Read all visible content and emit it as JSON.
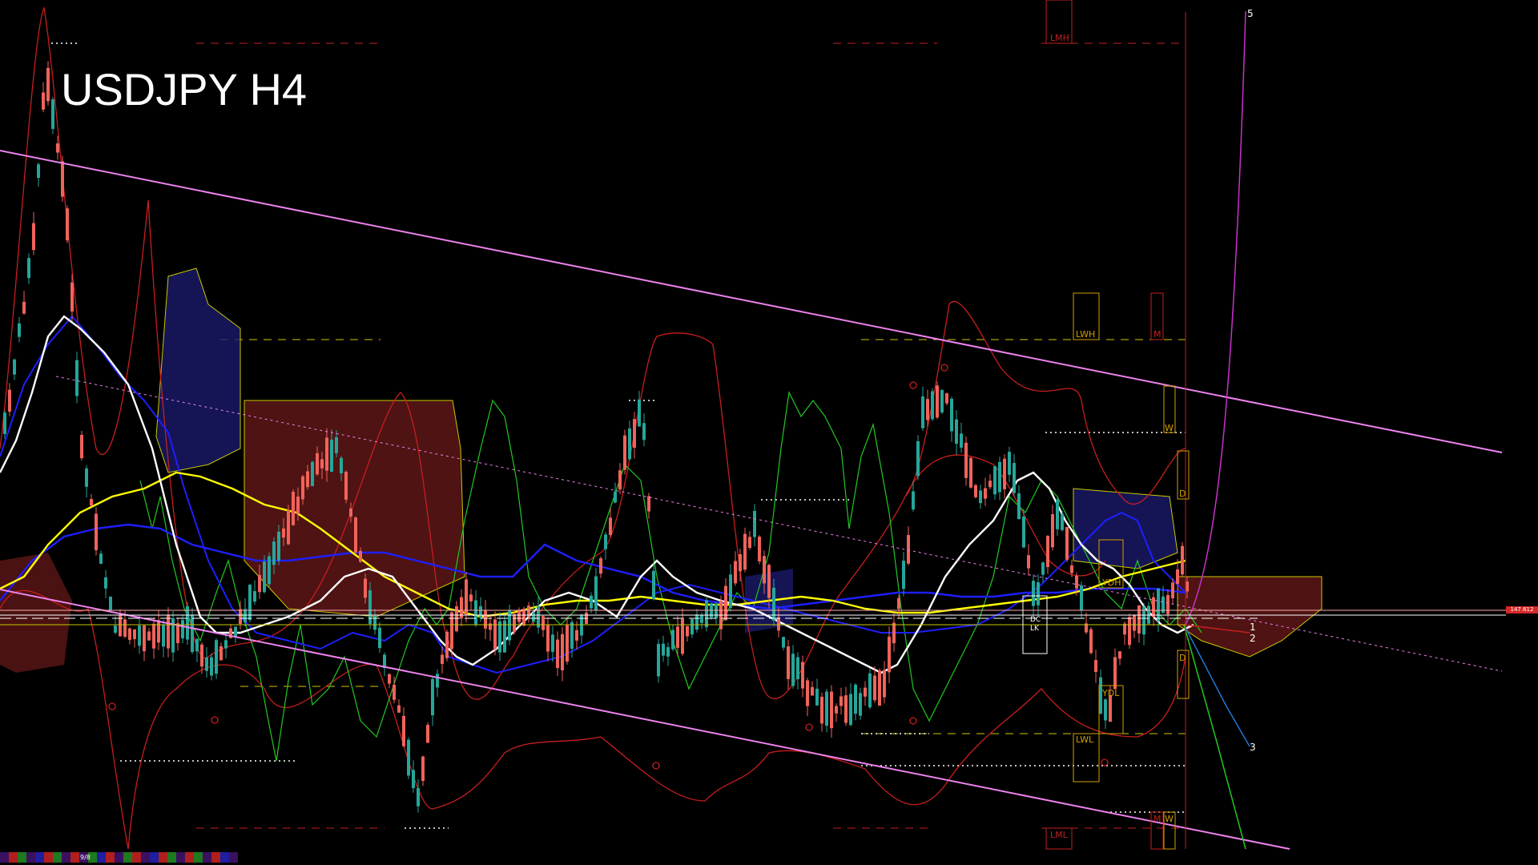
{
  "chart": {
    "title": "USDJPY H4",
    "price_tag": "147.612",
    "page_indicator": "9/8",
    "colors": {
      "background": "#000000",
      "bull_candle": "#26a69a",
      "bear_candle": "#f0635b",
      "channel": "#ee82ee",
      "ma_white": "#ffffff",
      "ma_yellow": "#ffff00",
      "ma_blue": "#1e1eff",
      "bollinger": "#c81e1e",
      "oscillator": "#22c822",
      "ichimoku_cloud": "#c8c800"
    },
    "labels": {
      "lmh": "LMH",
      "lml": "LML",
      "lwh": "LWH",
      "lwl": "LWL",
      "m_top": "M",
      "m_bottom": "M",
      "w_top": "W",
      "w_bottom": "W",
      "d_top": "D",
      "d_bottom": "D",
      "ydh": "YDH",
      "ydl": "YDL",
      "dc": "DC",
      "dc2": "LK"
    },
    "wave_labels": [
      "1",
      "2",
      "3",
      "5"
    ]
  }
}
